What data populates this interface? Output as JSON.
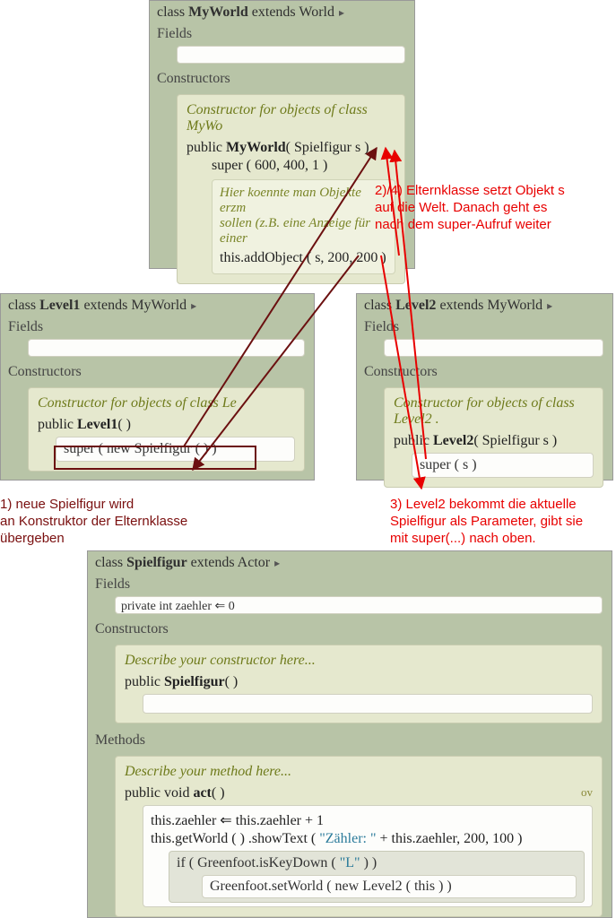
{
  "myworld": {
    "header_pre": "class ",
    "header_name": "MyWorld",
    "header_post": " extends World",
    "fields_label": "Fields",
    "ctors_label": "Constructors",
    "ctor_desc": "Constructor for objects of class MyWo",
    "sig_pre": "public ",
    "sig_name": "MyWorld",
    "sig_args": "( Spielfigur s )",
    "super_call": "super ( 600, 400, 1 )",
    "inner_comment_l1": "Hier koennte man Objekte erzm",
    "inner_comment_l2": "sollen (z.B. eine Anzeige für einer",
    "addobj": "this.addObject ( s, 200, 200 )"
  },
  "level1": {
    "header_pre": "class ",
    "header_name": "Level1",
    "header_post": " extends MyWorld",
    "fields_label": "Fields",
    "ctors_label": "Constructors",
    "ctor_desc": "Constructor for objects of class Le",
    "sig_pre": "public ",
    "sig_name": "Level1",
    "sig_args": "( )",
    "super_call": "super (  new  Spielfigur ( )  )"
  },
  "level2": {
    "header_pre": "class ",
    "header_name": "Level2",
    "header_post": " extends MyWorld",
    "fields_label": "Fields",
    "ctors_label": "Constructors",
    "ctor_desc": "Constructor for objects of class Level2 .",
    "sig_pre": "public ",
    "sig_name": "Level2",
    "sig_args": "( Spielfigur s )",
    "super_call": "super ( s )"
  },
  "spielfigur": {
    "header_pre": "class ",
    "header_name": "Spielfigur",
    "header_post": " extends Actor",
    "fields_label": "Fields",
    "field_line": "private int zaehler ⇐ 0",
    "ctors_label": "Constructors",
    "ctor_desc": "Describe your constructor here...",
    "sig_pre": "public ",
    "sig_name": "Spielfigur",
    "sig_args": "( )",
    "methods_label": "Methods",
    "meth_desc": "Describe your method here...",
    "act_pre": "public void ",
    "act_name": "act",
    "act_args": "( )",
    "act_ov": "ov",
    "act_l1": "this.zaehler ⇐ this.zaehler + 1",
    "act_l2a": "this.getWorld ( ) .showText ( ",
    "act_l2b": "\"Zähler: \"",
    "act_l2c": " + this.zaehler, 200, 100 )",
    "if_line_a": "if  ( Greenfoot.isKeyDown ( ",
    "if_line_b": "\"L\"",
    "if_line_c": " )  )",
    "if_body": "Greenfoot.setWorld (  new  Level2 ( this )  )"
  },
  "annotations": {
    "a1": "1) neue Spielfigur wird\nan Konstruktor der Elternklasse\nübergeben",
    "a2": "2)/4) Elternklasse setzt Objekt s\nauf die Welt. Danach geht es\nnach dem super-Aufruf weiter",
    "a3": "3) Level2 bekommt die aktuelle\nSpielfigur als Parameter, gibt sie\nmit super(...) nach oben."
  }
}
